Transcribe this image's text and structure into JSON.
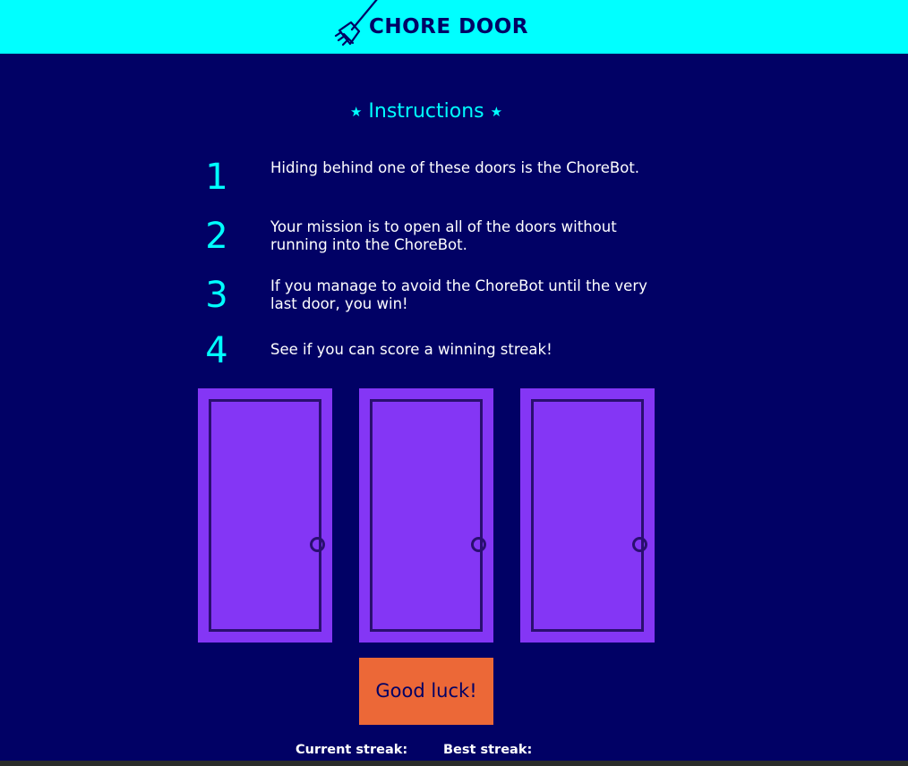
{
  "header": {
    "logo_icon": "broom-icon",
    "title": "CHORE DOOR",
    "background_color": "#00ffff",
    "text_color": "#010165"
  },
  "instructions": {
    "star_left": "★",
    "title": "Instructions",
    "star_right": "★",
    "steps": [
      {
        "number": "1",
        "text": "Hiding behind one of these doors is the ChoreBot."
      },
      {
        "number": "2",
        "text": "Your mission is to open all of the doors without running into the ChoreBot."
      },
      {
        "number": "3",
        "text": "If you manage to avoid the ChoreBot until the very last door, you win!"
      },
      {
        "number": "4",
        "text": "See if you can score a winning streak!"
      }
    ]
  },
  "doors": {
    "count": 3,
    "icon": "closed-door-icon",
    "color": "#8436f5",
    "outline_color": "#2a0f70"
  },
  "start_button": {
    "label": "Good luck!",
    "color": "#ec6837"
  },
  "streaks": {
    "current_label": "Current streak:",
    "best_label": "Best streak:"
  },
  "colors": {
    "background": "#010165",
    "accent": "#00ffff"
  }
}
